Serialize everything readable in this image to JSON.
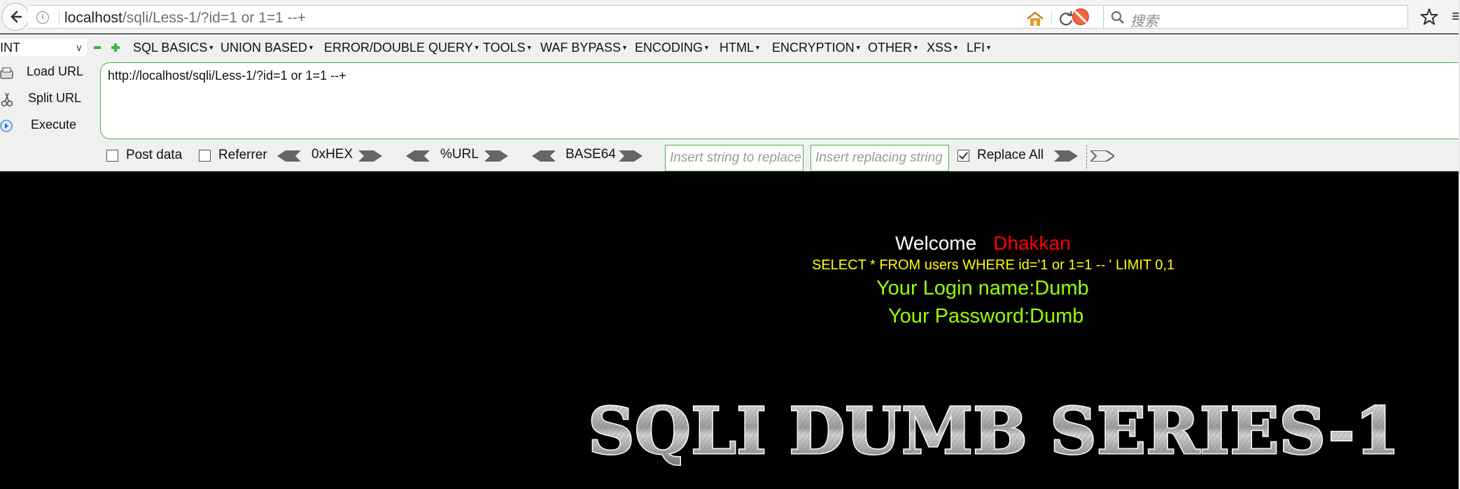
{
  "browser": {
    "url_host": "localhost",
    "url_path": "/sqli/Less-1/?id=1 or 1=1 --+",
    "search_placeholder": "搜索",
    "overflow_glyph": "≡"
  },
  "hackbar": {
    "select_value": "INT",
    "menus": [
      "SQL BASICS",
      "UNION BASED",
      "ERROR/DOUBLE QUERY",
      "TOOLS",
      "WAF BYPASS",
      "ENCODING",
      "HTML",
      "ENCRYPTION",
      "OTHER",
      "XSS",
      "LFI"
    ],
    "load_url": "Load URL",
    "split_url": "Split URL",
    "execute": "Execute",
    "url_value": "http://localhost/sqli/Less-1/?id=1 or 1=1 --+",
    "post_data": "Post data",
    "post_data_checked": false,
    "referrer": "Referrer",
    "referrer_checked": false,
    "hex": "0xHEX",
    "url_enc": "%URL",
    "base64": "BASE64",
    "replace_find_placeholder": "Insert string to replace",
    "replace_with_placeholder": "Insert replacing string",
    "replace_all": "Replace All",
    "replace_all_checked": true
  },
  "page": {
    "welcome": "Welcome",
    "user": "Dhakkan",
    "sql": "SELECT * FROM users WHERE id='1 or 1=1 -- ' LIMIT 0,1",
    "login": "Your Login name:Dumb",
    "password": "Your Password:Dumb",
    "banner": "SQLI DUMB SERIES-1"
  },
  "colors": {
    "accent_green": "#4caf50",
    "sql_yellow": "#ffff00",
    "result_green": "#99ff00",
    "user_red": "#ff0000"
  }
}
